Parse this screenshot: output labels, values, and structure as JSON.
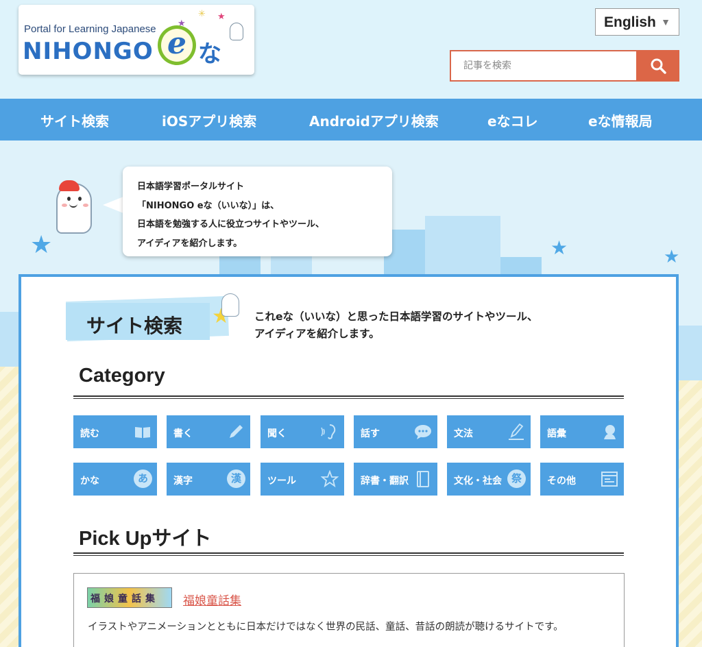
{
  "header": {
    "logo": {
      "tagline": "Portal for Learning Japanese",
      "wordmark": "NIHONGO",
      "e": "e",
      "na": "な"
    },
    "language": {
      "selected": "English"
    },
    "search": {
      "placeholder": "記事を検索"
    }
  },
  "nav": {
    "items": [
      {
        "label": "サイト検索"
      },
      {
        "label": "iOSアプリ検索"
      },
      {
        "label": "Androidアプリ検索"
      },
      {
        "label": "eなコレ"
      },
      {
        "label": "eな情報局"
      }
    ]
  },
  "hero": {
    "bubble_lines": [
      "日本語学習ポータルサイト",
      "「NIHONGO eな（いいな）」は、",
      "日本語を勉強する人に役立つサイトやツール、",
      "アイディアを紹介します。"
    ]
  },
  "main": {
    "section_title": "サイト検索",
    "section_desc_lines": [
      "これeな（いいな）と思った日本語学習のサイトやツール、",
      "アイディアを紹介します。"
    ],
    "category_heading": "Category",
    "categories": [
      {
        "label": "読む",
        "icon": "book-icon"
      },
      {
        "label": "書く",
        "icon": "pencil-icon"
      },
      {
        "label": "聞く",
        "icon": "ear-icon"
      },
      {
        "label": "話す",
        "icon": "speech-bubble-icon"
      },
      {
        "label": "文法",
        "icon": "pen-write-icon"
      },
      {
        "label": "語彙",
        "icon": "person-bust-icon"
      },
      {
        "label": "かな",
        "icon": "kana-a-icon",
        "glyph": "あ"
      },
      {
        "label": "漢字",
        "icon": "kanji-icon",
        "glyph": "漢"
      },
      {
        "label": "ツール",
        "icon": "star-icon"
      },
      {
        "label": "辞書・翻訳",
        "icon": "dictionary-icon"
      },
      {
        "label": "文化・社会",
        "icon": "festival-fan-icon",
        "glyph": "祭"
      },
      {
        "label": "その他",
        "icon": "window-icon"
      }
    ],
    "pickup_heading": "Pick Upサイト",
    "pickup": {
      "thumb_text": "福娘童話集",
      "title": "福娘童話集",
      "description": "イラストやアニメーションとともに日本だけではなく世界の民話、童話、昔話の朗読が聴けるサイトです。"
    }
  },
  "colors": {
    "nav_blue": "#4ea1e2",
    "search_orange": "#dc6647",
    "background": "#dff2fa",
    "link_red": "#d9564a"
  }
}
